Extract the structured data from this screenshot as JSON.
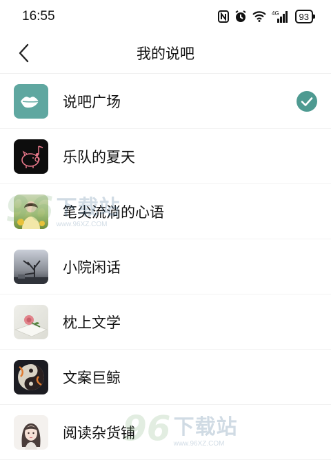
{
  "status_bar": {
    "time": "16:55",
    "battery": "93",
    "network": "4G",
    "icons": [
      "nfc-icon",
      "alarm-icon",
      "wifi-icon",
      "signal-icon",
      "battery-icon"
    ]
  },
  "header": {
    "title": "我的说吧",
    "back_icon": "chevron-left-icon"
  },
  "list": {
    "items": [
      {
        "label": "说吧广场",
        "icon": "lips-icon",
        "selected": true
      },
      {
        "label": "乐队的夏天",
        "icon": "piggy-band-logo"
      },
      {
        "label": "笔尖流淌的心语",
        "icon": "girl-photo"
      },
      {
        "label": "小院闲话",
        "icon": "tree-photo"
      },
      {
        "label": "枕上文学",
        "icon": "rose-photo"
      },
      {
        "label": "文案巨鲸",
        "icon": "yin-yang-photo"
      },
      {
        "label": "阅读杂货铺",
        "icon": "illustrated-girl-photo"
      }
    ]
  },
  "watermark": {
    "digits": "96",
    "title": "下载站",
    "url": "www.96XZ.COM"
  },
  "colors": {
    "accent": "#5fa7a0",
    "check": "#4e9a91",
    "divider": "#f2f2f2"
  }
}
